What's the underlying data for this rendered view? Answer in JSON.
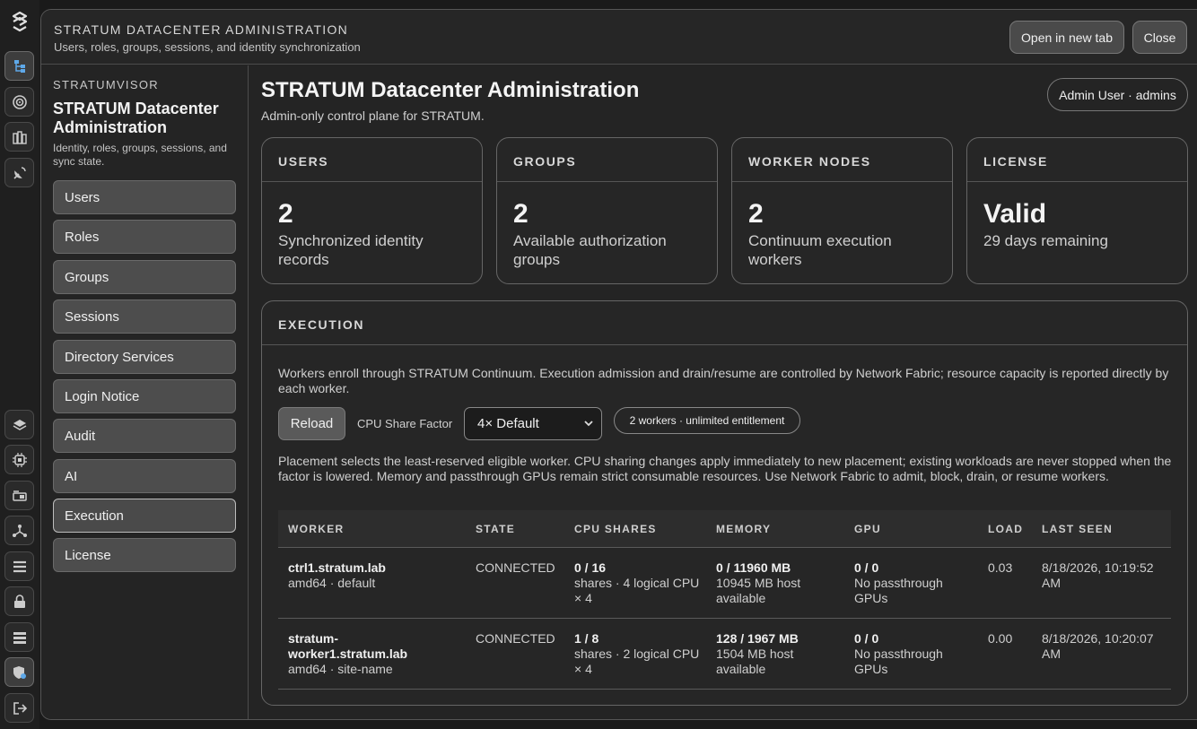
{
  "window": {
    "title": "STRATUM DATACENTER ADMINISTRATION",
    "subtitle": "Users, roles, groups, sessions, and identity synchronization",
    "open_new_tab": "Open in new tab",
    "close": "Close"
  },
  "sidebar": {
    "eyebrow": "STRATUMVISOR",
    "title": "STRATUM Datacenter Administration",
    "description": "Identity, roles, groups, sessions, and sync state.",
    "items": [
      {
        "label": "Users"
      },
      {
        "label": "Roles"
      },
      {
        "label": "Groups"
      },
      {
        "label": "Sessions"
      },
      {
        "label": "Directory Services"
      },
      {
        "label": "Login Notice"
      },
      {
        "label": "Audit"
      },
      {
        "label": "AI"
      },
      {
        "label": "Execution",
        "active": true
      },
      {
        "label": "License"
      }
    ]
  },
  "main": {
    "title": "STRATUM Datacenter Administration",
    "subtitle": "Admin-only control plane for STRATUM.",
    "user_pill": "Admin User · admins",
    "cards": [
      {
        "head": "USERS",
        "value": "2",
        "desc": "Synchronized identity records"
      },
      {
        "head": "GROUPS",
        "value": "2",
        "desc": "Available authorization groups"
      },
      {
        "head": "WORKER NODES",
        "value": "2",
        "desc": "Continuum execution workers"
      },
      {
        "head": "LICENSE",
        "value": "Valid",
        "desc": "29 days remaining"
      }
    ]
  },
  "execution": {
    "head": "EXECUTION",
    "intro": "Workers enroll through STRATUM Continuum. Execution admission and drain/resume are controlled by Network Fabric; resource capacity is reported directly by each worker.",
    "reload": "Reload",
    "share_label": "CPU Share Factor",
    "share_value": "4× Default",
    "workers_pill": "2 workers · unlimited entitlement",
    "note": "Placement selects the least-reserved eligible worker. CPU sharing changes apply immediately to new placement; existing workloads are never stopped when the factor is lowered. Memory and passthrough GPUs remain strict consumable resources. Use Network Fabric to admit, block, drain, or resume workers.",
    "columns": [
      "WORKER",
      "STATE",
      "CPU SHARES",
      "MEMORY",
      "GPU",
      "LOAD",
      "LAST SEEN"
    ],
    "rows": [
      {
        "worker": "ctrl1.stratum.lab",
        "worker_sub": "amd64 · default",
        "state": "CONNECTED",
        "cpu": "0 / 16",
        "cpu_sub": "shares · 4 logical CPU × 4",
        "mem": "0 / 11960 MB",
        "mem_sub": "10945 MB host available",
        "gpu": "0 / 0",
        "gpu_sub": "No passthrough GPUs",
        "load": "0.03",
        "seen": "8/18/2026, 10:19:52 AM"
      },
      {
        "worker": "stratum-worker1.stratum.lab",
        "worker_sub": "amd64 · site-name",
        "state": "CONNECTED",
        "cpu": "1 / 8",
        "cpu_sub": "shares · 2 logical CPU × 4",
        "mem": "128 / 1967 MB",
        "mem_sub": "1504 MB host available",
        "gpu": "0 / 0",
        "gpu_sub": "No passthrough GPUs",
        "load": "0.00",
        "seen": "8/18/2026, 10:20:07 AM"
      }
    ]
  },
  "rail": {
    "icons": [
      "stratum-logo-icon",
      "topology-icon",
      "target-icon",
      "datacenter-icon",
      "satellite-icon",
      "layers-icon",
      "cpu-icon",
      "storage-icon",
      "network-icon",
      "list-icon",
      "lock-icon",
      "server-list-icon",
      "admin-shield-icon",
      "logout-icon"
    ]
  }
}
